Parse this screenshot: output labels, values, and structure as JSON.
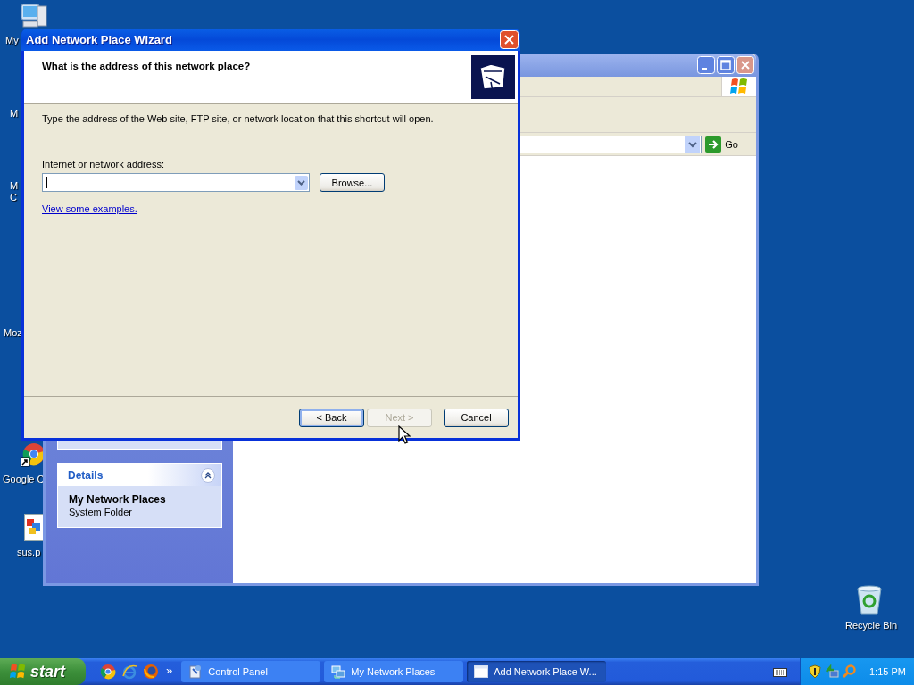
{
  "desktop_icons": [
    {
      "kind": "computer",
      "lines": [
        "My"
      ]
    },
    {
      "kind": "hidden",
      "lines": [
        "M"
      ]
    },
    {
      "kind": "hidden",
      "lines": [
        "M",
        "C"
      ]
    },
    {
      "kind": "hidden",
      "lines": [
        "Moz"
      ]
    },
    {
      "kind": "chrome",
      "lines": [
        "Google C"
      ]
    },
    {
      "kind": "document",
      "lines": [
        "sus.p"
      ]
    }
  ],
  "recycle_bin": {
    "label": "Recycle Bin"
  },
  "explorer_window": {
    "go_label": "Go",
    "details": {
      "title": "Details",
      "name": "My Network Places",
      "type": "System Folder"
    }
  },
  "wizard": {
    "title": "Add Network Place Wizard",
    "heading": "What is the address of this network place?",
    "instruction": "Type the address of the Web site, FTP site, or network location that this shortcut will open.",
    "address_label": "Internet or network address:",
    "browse": "Browse...",
    "link": "View some examples.",
    "buttons": [
      {
        "label": "< Back",
        "disabled": false,
        "default": true
      },
      {
        "label": "Next >",
        "disabled": true,
        "default": false
      },
      {
        "label": "Cancel",
        "disabled": false,
        "default": false
      }
    ]
  },
  "taskbar": {
    "start": "start",
    "chevron": "»",
    "tasks": [
      {
        "kind": "control",
        "label": "Control Panel",
        "selected": false
      },
      {
        "kind": "network",
        "label": "My Network Places",
        "selected": false
      },
      {
        "kind": "window",
        "label": "Add Network Place W...",
        "selected": true
      }
    ],
    "clock": "1:15 PM"
  }
}
